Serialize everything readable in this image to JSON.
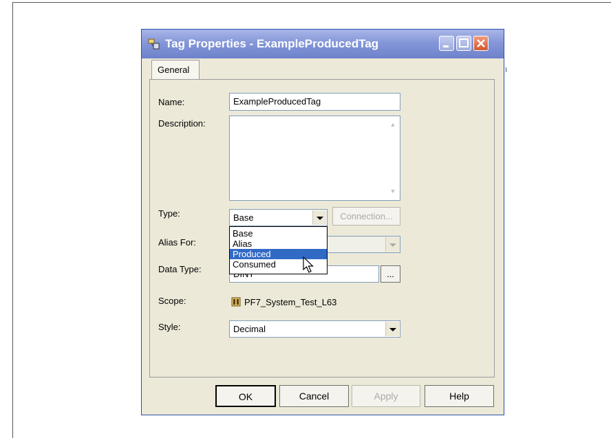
{
  "window": {
    "title": "Tag Properties - ExampleProducedTag"
  },
  "tabs": [
    {
      "label": "General"
    }
  ],
  "form": {
    "name_label": "Name:",
    "name_value": "ExampleProducedTag",
    "description_label": "Description:",
    "description_value": "",
    "type_label": "Type:",
    "type_value": "Base",
    "connection_button": "Connection...",
    "alias_label": "Alias For:",
    "data_type_label": "Data Type:",
    "data_type_value": "DINT",
    "data_type_browse": "...",
    "scope_label": "Scope:",
    "scope_value": "PF7_System_Test_L63",
    "style_label": "Style:",
    "style_value": "Decimal"
  },
  "type_dropdown": {
    "options": [
      "Base",
      "Alias",
      "Produced",
      "Consumed"
    ],
    "highlighted": "Produced"
  },
  "buttons": {
    "ok": "OK",
    "cancel": "Cancel",
    "apply": "Apply",
    "help": "Help"
  },
  "colors": {
    "titlebar": "#8597d8",
    "selection": "#316ac5",
    "window_bg": "#ece9d8"
  }
}
